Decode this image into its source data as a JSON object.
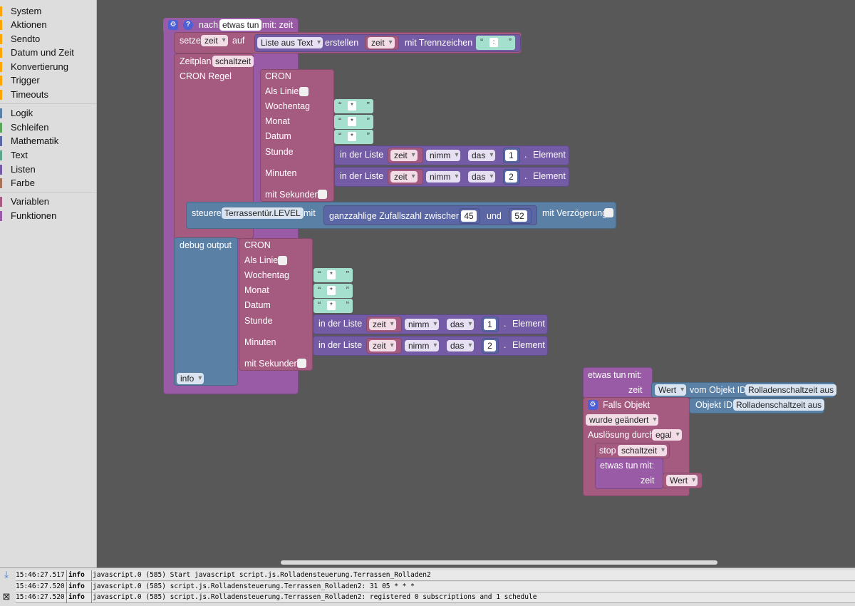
{
  "sidebar": {
    "items": [
      "System",
      "Aktionen",
      "Sendto",
      "Datum und Zeit",
      "Konvertierung",
      "Trigger",
      "Timeouts",
      "Logik",
      "Schleifen",
      "Mathematik",
      "Text",
      "Listen",
      "Farbe",
      "Variablen",
      "Funktionen"
    ]
  },
  "colors": {
    "func": "#995ba5",
    "var": "#a55b80",
    "ts": "#a55b80",
    "debug": "#5b80a5",
    "list": "#745ba5",
    "math": "#5b67a5",
    "text": "#a5e0cf"
  },
  "fn": {
    "nach": "nach",
    "name": "etwas tun",
    "params": "mit: zeit"
  },
  "setze": {
    "setze": "setze",
    "var": "zeit",
    "auf": "auf",
    "list_mode": "Liste aus Text",
    "erstellen": "erstellen",
    "zeit": "zeit",
    "sep_label": "mit Trennzeichen",
    "sep_value": ":"
  },
  "zeitplan": {
    "label": "Zeitplan",
    "var": "schaltzeit",
    "cron_regel": "CRON Regel"
  },
  "cron": {
    "title": "CRON",
    "als_linie": "Als Linie",
    "wochentag": "Wochentag",
    "monat": "Monat",
    "datum": "Datum",
    "stunde": "Stunde",
    "minuten": "Minuten",
    "mit_sekunden": "mit Sekunden",
    "star": "*"
  },
  "list_get": {
    "in_der_liste": "in der Liste",
    "zeit": "zeit",
    "nimm": "nimm",
    "das": "das",
    "element": "Element",
    "dot": ".",
    "idx1": "1",
    "idx2": "2"
  },
  "steuere": {
    "label": "steuere",
    "state": "Terrassentür.LEVEL",
    "mit": "mit",
    "random": "ganzzahlige Zufallszahl zwischen",
    "min": "45",
    "und": "und",
    "max": "52",
    "delay": "mit Verzögerung"
  },
  "debug": {
    "label": "debug output",
    "level": "info"
  },
  "fn_call": {
    "label": "etwas tun",
    "mit": "mit:",
    "zeit": "zeit",
    "wert": "Wert",
    "vom": "vom Objekt ID",
    "obj": "Rolladenschaltzeit aus"
  },
  "trigger": {
    "falls": "Falls Objekt",
    "objid": "Objekt ID",
    "obj": "Rolladenschaltzeit aus",
    "geaendert": "wurde geändert",
    "ausloesung": "Auslösung durch",
    "egal": "egal",
    "stop": "stop",
    "schaltzeit": "schaltzeit",
    "etwas": "etwas tun",
    "mit": "mit:",
    "zeit": "zeit",
    "wert": "Wert"
  },
  "log": [
    {
      "time": "15:46:27.517",
      "level": "info",
      "msg": "javascript.0 (585) Start javascript script.js.Rolladensteuerung.Terrassen_Rolladen2"
    },
    {
      "time": "15:46:27.520",
      "level": "info",
      "msg": "javascript.0 (585) script.js.Rolladensteuerung.Terrassen_Rolladen2: 31 05 * * *"
    },
    {
      "time": "15:46:27.520",
      "level": "info",
      "msg": "javascript.0 (585) script.js.Rolladensteuerung.Terrassen_Rolladen2: registered 0 subscriptions and 1 schedule"
    }
  ]
}
